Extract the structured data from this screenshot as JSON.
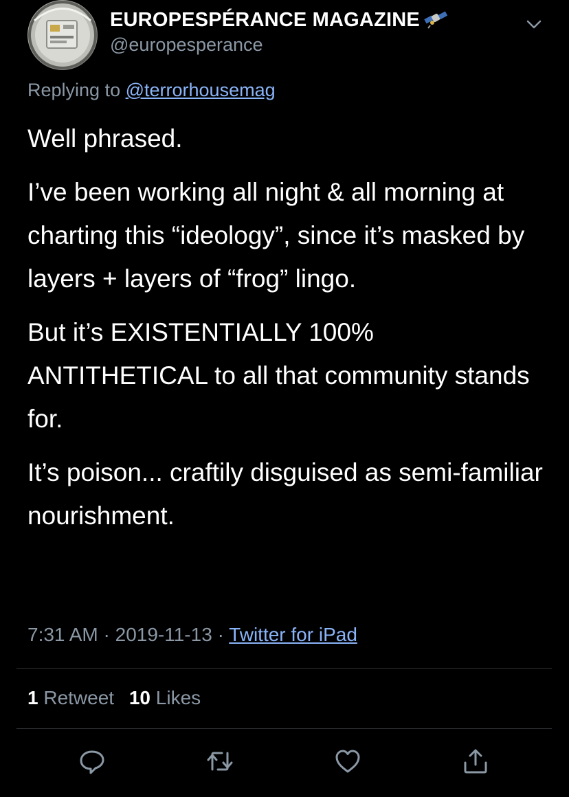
{
  "author": {
    "display_name": "EUROPESPÉRANCE MAGAZINE",
    "handle": "@europesperance",
    "name_emoji": "satellite-icon"
  },
  "reply": {
    "prefix": "Replying to",
    "mention": "@terrorhousemag"
  },
  "tweet": {
    "paragraphs": [
      "Well phrased.",
      "I’ve been working all night & all morning at charting this “ideology”, since it’s masked by layers + layers of “frog” lingo.",
      "But it’s EXISTENTIALLY 100% ANTITHETICAL to all that community stands for.",
      "It’s poison... craftily disguised as semi-familiar nourishment."
    ]
  },
  "meta": {
    "time": "7:31 AM",
    "separator": "·",
    "date": "2019-11-13",
    "source": "Twitter for iPad"
  },
  "stats": {
    "retweets_count": "1",
    "retweets_label": "Retweet",
    "likes_count": "10",
    "likes_label": "Likes"
  },
  "actions": {
    "reply_icon": "reply-icon",
    "retweet_icon": "retweet-icon",
    "like_icon": "heart-icon",
    "share_icon": "share-icon"
  },
  "colors": {
    "background": "#000000",
    "text": "#ffffff",
    "secondary": "#8b98a5",
    "link": "#8ab4f8",
    "divider": "#2f3336"
  }
}
